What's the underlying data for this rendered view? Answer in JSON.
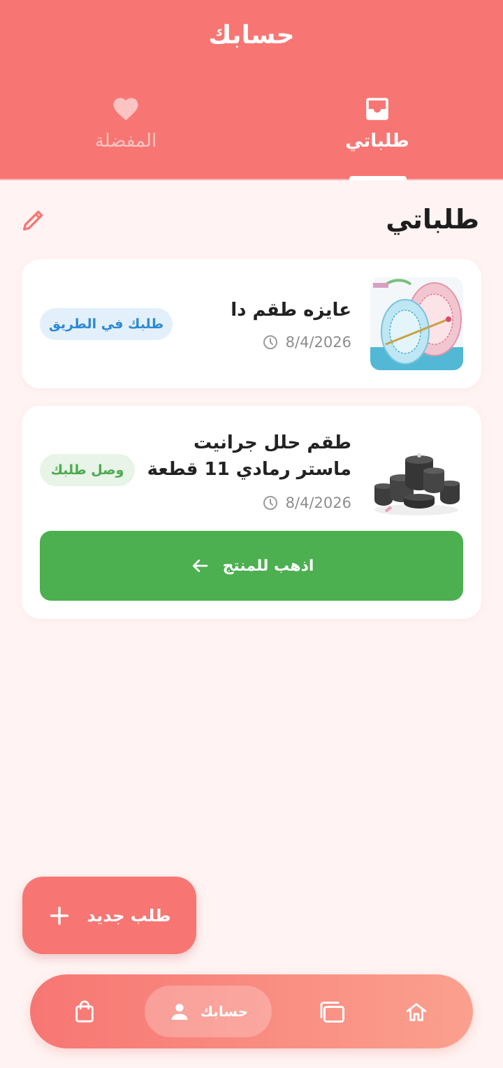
{
  "header": {
    "title": "حسابك",
    "tabs": {
      "orders_label": "طلباتي",
      "favorites_label": "المفضلة"
    }
  },
  "section": {
    "title": "طلباتي"
  },
  "orders": [
    {
      "title": "عايزه طقم دا",
      "date": "8/4/2026",
      "status": "طلبك في الطريق",
      "status_color": "#2c8ad4"
    },
    {
      "title": "طقم حلل جرانيت ماستر رمادي 11 قطعة",
      "date": "8/4/2026",
      "status": "وصل طلبك",
      "status_color": "#4caa4f",
      "action_label": "اذهب للمنتج"
    }
  ],
  "fab": {
    "label": "طلب جديد"
  },
  "bottom_nav": {
    "account_label": "حسابك",
    "items": [
      "home-icon",
      "offers-icon",
      "account-icon",
      "cart-icon"
    ]
  },
  "colors": {
    "primary": "#f77673",
    "background": "#fff4f3",
    "success": "#4caf50",
    "info": "#2c8ad4"
  }
}
